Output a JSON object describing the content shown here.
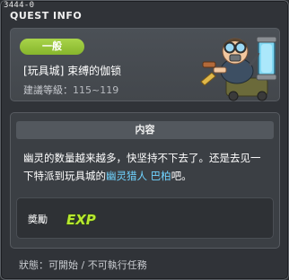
{
  "window": {
    "quest_id": "3444-0",
    "title": "QUEST INFO"
  },
  "header": {
    "type_badge": "一般",
    "quest_name": "[玩具城] 束缚的伽锁",
    "level_label": "建議等級：",
    "level_range": "115~119",
    "npc_icon": "npc-mechanic-character"
  },
  "content": {
    "section_title": "内容",
    "desc_part1": "幽灵的数量越来越多，快坚持不下去了。还是去见一下特派到玩具城的",
    "desc_highlight": "幽灵猎人 巴柏",
    "desc_part2": "吧。",
    "highlight_color": "#6fd3ff"
  },
  "reward": {
    "label": "奬勵",
    "exp_icon_text": "EXP"
  },
  "status": {
    "text": "狀態：可開始 / 不可執行任務"
  },
  "colors": {
    "badge": "#96c33a",
    "panel": "#43474c",
    "background": "#303338"
  }
}
